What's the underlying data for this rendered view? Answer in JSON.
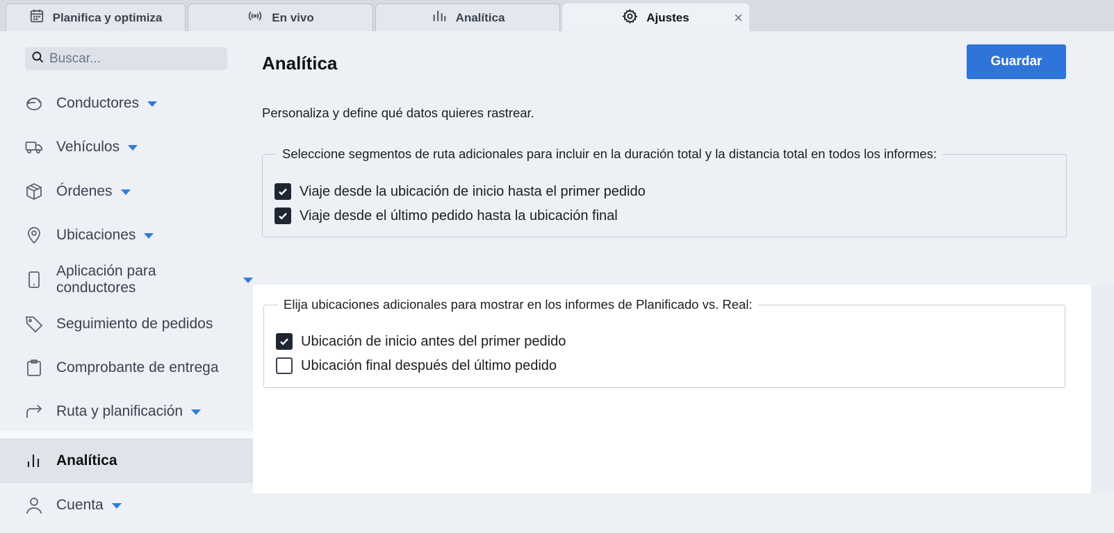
{
  "tabs": [
    {
      "label": "Planifica y optimiza",
      "icon": "calendar-icon"
    },
    {
      "label": "En vivo",
      "icon": "broadcast-icon"
    },
    {
      "label": "Analítica",
      "icon": "bar-chart-icon"
    },
    {
      "label": "Ajustes",
      "icon": "gear-icon",
      "active": true,
      "close": "×"
    }
  ],
  "search": {
    "placeholder": "Buscar..."
  },
  "sidebar": {
    "items": [
      {
        "label": "Conductores",
        "icon": "driver-icon",
        "dropdown": true
      },
      {
        "label": "Vehículos",
        "icon": "truck-icon",
        "dropdown": true
      },
      {
        "label": "Órdenes",
        "icon": "box-icon",
        "dropdown": true
      },
      {
        "label": "Ubicaciones",
        "icon": "map-pin-icon",
        "dropdown": true
      },
      {
        "label": "Aplicación para conductores",
        "icon": "phone-icon",
        "dropdown": true
      },
      {
        "label": "Seguimiento de pedidos",
        "icon": "tag-icon",
        "dropdown": false
      },
      {
        "label": "Comprobante de entrega",
        "icon": "clipboard-icon",
        "dropdown": false
      },
      {
        "label": "Ruta y planificación",
        "icon": "route-arrow-icon",
        "dropdown": true
      },
      {
        "label": "Analítica",
        "icon": "bar-chart-icon",
        "dropdown": false,
        "active": true
      },
      {
        "label": "Cuenta",
        "icon": "user-icon",
        "dropdown": true
      }
    ]
  },
  "main": {
    "title": "Analítica",
    "save_label": "Guardar",
    "intro": "Personaliza y define qué datos quieres rastrear.",
    "group1": {
      "legend": "Seleccione segmentos de ruta adicionales para incluir en la duración total y la distancia total en todos los informes:",
      "options": [
        {
          "label": "Viaje desde la ubicación de inicio hasta el primer pedido",
          "checked": true
        },
        {
          "label": "Viaje desde el último pedido hasta la ubicación final",
          "checked": true
        }
      ]
    },
    "group2": {
      "legend": "Elija ubicaciones adicionales para mostrar en los informes de Planificado vs. Real:",
      "options": [
        {
          "label": "Ubicación de inicio antes del primer pedido",
          "checked": true
        },
        {
          "label": "Ubicación final después del último pedido",
          "checked": false
        }
      ]
    }
  },
  "colors": {
    "accent": "#2f74d8",
    "caret": "#2f7be0",
    "checkbox_checked": "#1f2633"
  }
}
